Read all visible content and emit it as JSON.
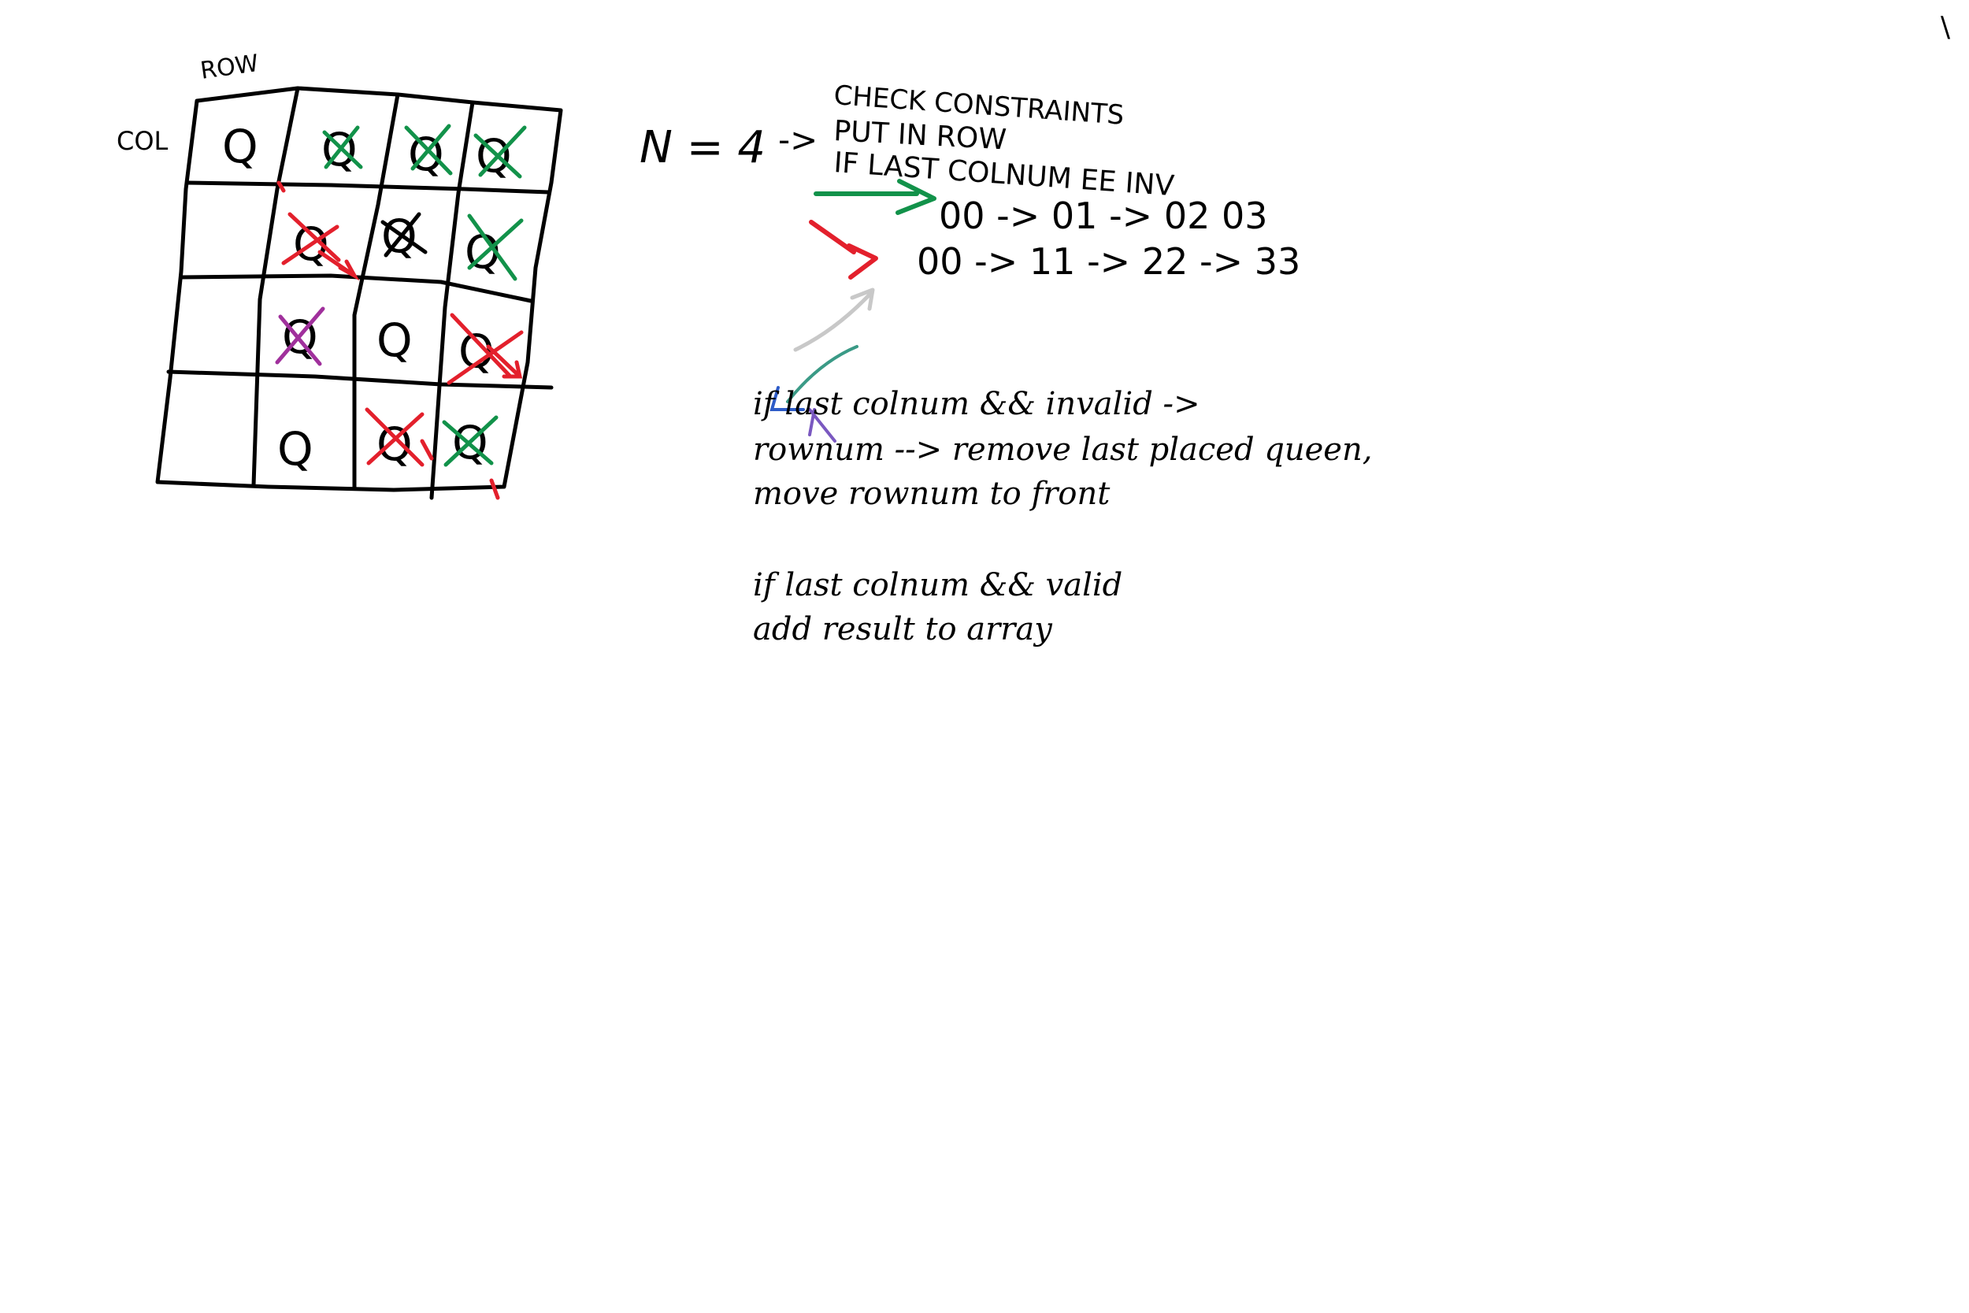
{
  "colors": {
    "ink": "#000000",
    "green": "#12924a",
    "red": "#e3202c",
    "purple": "#a0309c",
    "gray": "#c8c8c8",
    "teal": "#3a9a86",
    "blue": "#2e5cc8",
    "violet": "#7a58c0"
  },
  "grid": {
    "row_label": "ROW",
    "col_label": "COL",
    "queen_glyph": "Q",
    "cells": [
      [
        "Q",
        "Q-green-x",
        "Q-green-x",
        "Q-green-x"
      ],
      [
        "",
        "Q-red-x",
        "Q-black-x",
        "Q-green-x"
      ],
      [
        "",
        "Q-purple-x",
        "Q",
        "Q-red-x"
      ],
      [
        "",
        "Q",
        "Q-red-x",
        "Q-green-x"
      ]
    ]
  },
  "notes": {
    "n_value": "N = 4",
    "arrow": "->",
    "step1": "CHECK CONSTRAINTS",
    "step2": "PUT IN ROW",
    "step3": "IF LAST COLNUM EE INV",
    "seq_green": "00 -> 01 -> 02 03",
    "seq_red": "00 -> 11 -> 22 -> 33",
    "rule1_line1": "if last colnum && invalid ->",
    "rule1_line2": "rownum --> remove last placed queen,",
    "rule1_line3": "move rownum to front",
    "rule2_line1": "if last colnum && valid",
    "rule2_line2": "add result to array",
    "corner_mark": "\\"
  }
}
